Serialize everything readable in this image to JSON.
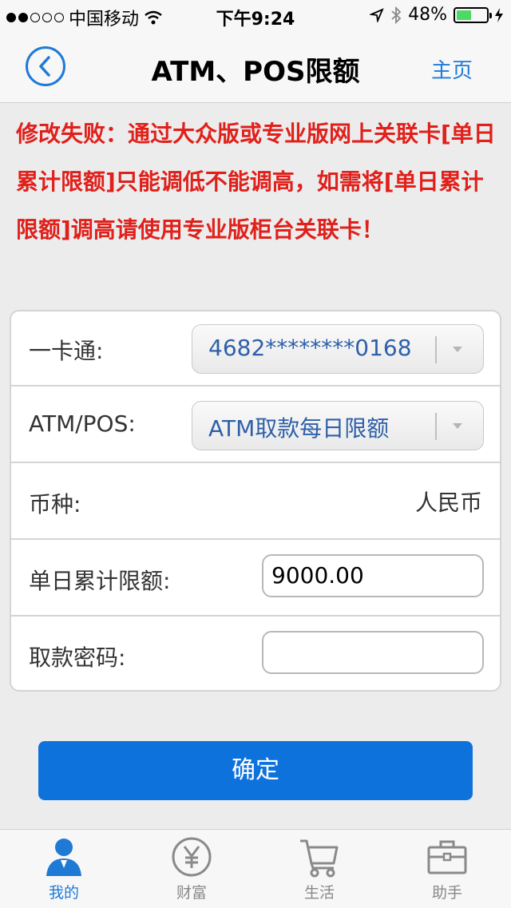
{
  "status_bar": {
    "carrier": "中国移动",
    "time": "下午9:24",
    "battery": "48%",
    "battery_level": 0.48,
    "icons": [
      "signal-dots-icon",
      "wifi-icon",
      "location-arrow-icon",
      "bluetooth-icon",
      "battery-icon",
      "charging-bolt-icon"
    ]
  },
  "navbar": {
    "title": "ATM、POS限额",
    "home_label": "主页",
    "back_icon": "back-chevron-icon"
  },
  "error_message": "修改失败：通过大众版或专业版网上关联卡[单日累计限额]只能调低不能调高，如需将[单日累计限额]调高请使用专业版柜台关联卡！",
  "form": {
    "card_label": "一卡通:",
    "card_value": "4682********0168",
    "type_label": "ATM/POS:",
    "type_value": "ATM取款每日限额",
    "currency_label": "币种:",
    "currency_value": "人民币",
    "limit_label": "单日累计限额:",
    "limit_value": "9000.00",
    "password_label": "取款密码:",
    "password_value": ""
  },
  "confirm_label": "确定",
  "colors": {
    "accent": "#1f7ad6",
    "button": "#0e72dd",
    "error": "#e0201b"
  },
  "tabbar": {
    "tabs": [
      {
        "label": "我的",
        "icon": "user-icon",
        "active": true
      },
      {
        "label": "财富",
        "icon": "yen-coin-icon",
        "active": false
      },
      {
        "label": "生活",
        "icon": "shopping-cart-icon",
        "active": false
      },
      {
        "label": "助手",
        "icon": "briefcase-icon",
        "active": false
      }
    ]
  }
}
